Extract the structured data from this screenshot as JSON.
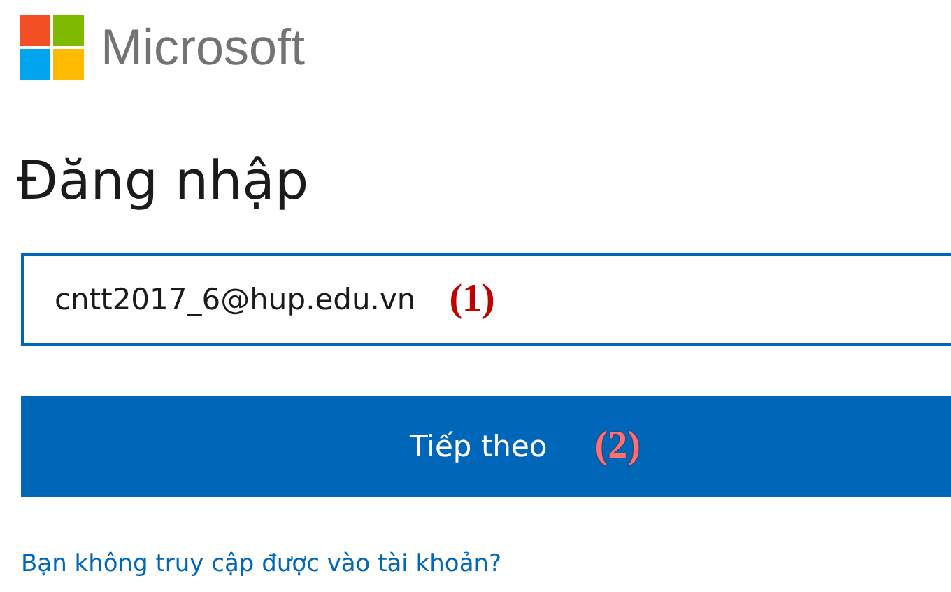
{
  "logo": {
    "text": "Microsoft"
  },
  "heading": "Đăng nhập",
  "email_field": {
    "value": "cntt2017_6@hup.edu.vn",
    "annotation": "(1)"
  },
  "next_button": {
    "label": "Tiếp theo",
    "annotation": "(2)"
  },
  "help_link": "Bạn không truy cập được vào tài khoản?"
}
